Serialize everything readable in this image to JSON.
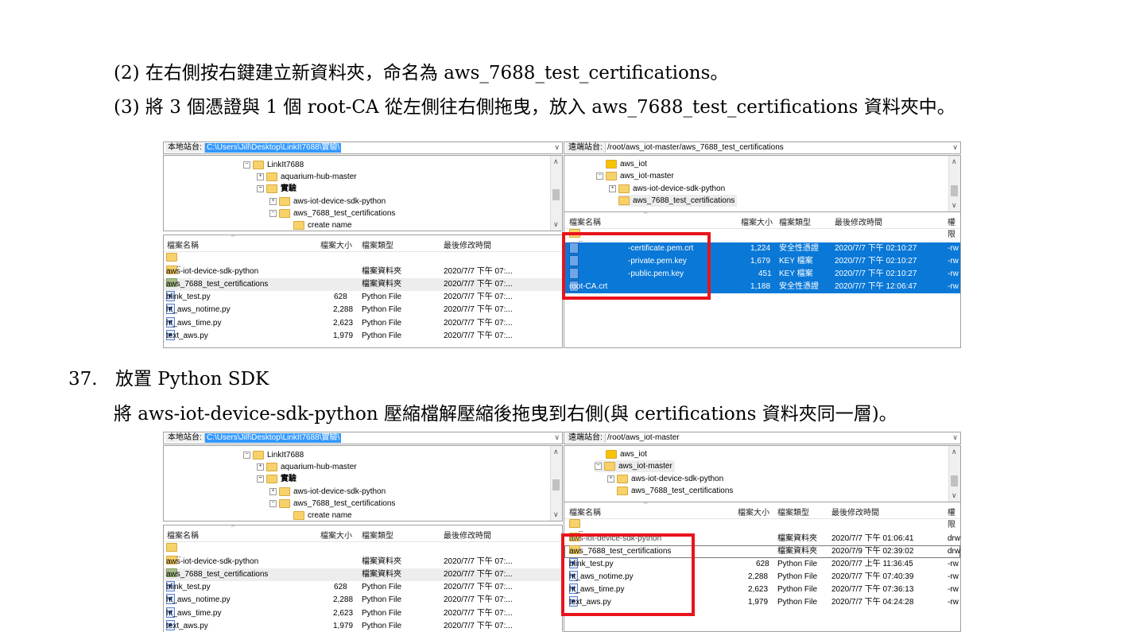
{
  "doc": {
    "line1": "(2) 在右側按右鍵建立新資料夾，命名為 aws_7688_test_certifications。",
    "line2": "(3) 將 3 個憑證與 1 個 root-CA 從左側往右側拖曳，放入 aws_7688_test_certifications 資料夾中。",
    "section_num": "37.",
    "section_title": "放置 Python SDK",
    "line3": "將 aws-iot-device-sdk-python 壓縮檔解壓縮後拖曳到右側(與 certifications 資料夾同一層)。"
  },
  "colors": {
    "selection_blue": "#0a78d7",
    "highlight_red": "#e8141c",
    "path_blue": "#3399ff"
  },
  "shot1": {
    "left": {
      "path_label": "本地站台:",
      "path_value": "C:\\Users\\Jill\\Desktop\\LinkIt7688\\實驗\\",
      "tree": [
        "LinkIt7688",
        "aquarium-hub-master",
        "實驗",
        "aws-iot-device-sdk-python",
        "aws_7688_test_certifications",
        "create name"
      ],
      "headers": {
        "name": "檔案名稱",
        "size": "檔案大小",
        "type": "檔案類型",
        "modified": "最後修改時間"
      },
      "rows": [
        {
          "name": "..",
          "size": "",
          "type": "",
          "modified": ""
        },
        {
          "name": "aws-iot-device-sdk-python",
          "size": "",
          "type": "檔案資料夾",
          "modified": "2020/7/7 下午 07:..."
        },
        {
          "name": "aws_7688_test_certifications",
          "size": "",
          "type": "檔案資料夾",
          "modified": "2020/7/7 下午 07:..."
        },
        {
          "name": "blink_test.py",
          "size": "628",
          "type": "Python File",
          "modified": "2020/7/7 下午 07:..."
        },
        {
          "name": "ht_aws_notime.py",
          "size": "2,288",
          "type": "Python File",
          "modified": "2020/7/7 下午 07:..."
        },
        {
          "name": "ht_aws_time.py",
          "size": "2,623",
          "type": "Python File",
          "modified": "2020/7/7 下午 07:..."
        },
        {
          "name": "text_aws.py",
          "size": "1,979",
          "type": "Python File",
          "modified": "2020/7/7 下午 07:..."
        }
      ]
    },
    "right": {
      "path_label": "遠端站台:",
      "path_value": "/root/aws_iot-master/aws_7688_test_certifications",
      "tree": [
        "aws_iot",
        "aws_iot-master",
        "aws-iot-device-sdk-python",
        "aws_7688_test_certifications"
      ],
      "headers": {
        "name": "檔案名稱",
        "size": "檔案大小",
        "type": "檔案類型",
        "modified": "最後修改時間",
        "perm": "權限"
      },
      "rows": [
        {
          "name": "..",
          "size": "",
          "type": "",
          "modified": "",
          "perm": ""
        },
        {
          "name": "-certificate.pem.crt",
          "size": "1,224",
          "type": "安全性憑證",
          "modified": "2020/7/7 下午 02:10:27",
          "perm": "-rw"
        },
        {
          "name": "-private.pem.key",
          "size": "1,679",
          "type": "KEY 檔案",
          "modified": "2020/7/7 下午 02:10:27",
          "perm": "-rw"
        },
        {
          "name": "-public.pem.key",
          "size": "451",
          "type": "KEY 檔案",
          "modified": "2020/7/7 下午 02:10:27",
          "perm": "-rw"
        },
        {
          "name": "root-CA.crt",
          "size": "1,188",
          "type": "安全性憑證",
          "modified": "2020/7/7 下午 12:06:47",
          "perm": "-rw"
        }
      ]
    }
  },
  "shot2": {
    "left": {
      "path_label": "本地站台:",
      "path_value": "C:\\Users\\Jill\\Desktop\\LinkIt7688\\實驗\\",
      "tree": [
        "LinkIt7688",
        "aquarium-hub-master",
        "實驗",
        "aws-iot-device-sdk-python",
        "aws_7688_test_certifications",
        "create name"
      ],
      "headers": {
        "name": "檔案名稱",
        "size": "檔案大小",
        "type": "檔案類型",
        "modified": "最後修改時間"
      },
      "rows": [
        {
          "name": "..",
          "size": "",
          "type": "",
          "modified": ""
        },
        {
          "name": "aws-iot-device-sdk-python",
          "size": "",
          "type": "檔案資料夾",
          "modified": "2020/7/7 下午 07:..."
        },
        {
          "name": "aws_7688_test_certifications",
          "size": "",
          "type": "檔案資料夾",
          "modified": "2020/7/7 下午 07:..."
        },
        {
          "name": "blink_test.py",
          "size": "628",
          "type": "Python File",
          "modified": "2020/7/7 下午 07:..."
        },
        {
          "name": "ht_aws_notime.py",
          "size": "2,288",
          "type": "Python File",
          "modified": "2020/7/7 下午 07:..."
        },
        {
          "name": "ht_aws_time.py",
          "size": "2,623",
          "type": "Python File",
          "modified": "2020/7/7 下午 07:..."
        },
        {
          "name": "text_aws.py",
          "size": "1,979",
          "type": "Python File",
          "modified": "2020/7/7 下午 07:..."
        }
      ]
    },
    "right": {
      "path_label": "遠端站台:",
      "path_value": "/root/aws_iot-master",
      "tree": [
        "aws_iot",
        "aws_iot-master",
        "aws-iot-device-sdk-python",
        "aws_7688_test_certifications"
      ],
      "headers": {
        "name": "檔案名稱",
        "size": "檔案大小",
        "type": "檔案類型",
        "modified": "最後修改時間",
        "perm": "權限"
      },
      "rows": [
        {
          "name": "..",
          "size": "",
          "type": "",
          "modified": "",
          "perm": ""
        },
        {
          "name": "aws-iot-device-sdk-python",
          "size": "",
          "type": "檔案資料夾",
          "modified": "2020/7/7 下午 01:06:41",
          "perm": "drw"
        },
        {
          "name": "aws_7688_test_certifications",
          "size": "",
          "type": "檔案資料夾",
          "modified": "2020/7/9 下午 02:39:02",
          "perm": "drw"
        },
        {
          "name": "blink_test.py",
          "size": "628",
          "type": "Python File",
          "modified": "2020/7/7 上午 11:36:45",
          "perm": "-rw"
        },
        {
          "name": "ht_aws_notime.py",
          "size": "2,288",
          "type": "Python File",
          "modified": "2020/7/7 下午 07:40:39",
          "perm": "-rw"
        },
        {
          "name": "ht_aws_time.py",
          "size": "2,623",
          "type": "Python File",
          "modified": "2020/7/7 下午 07:36:13",
          "perm": "-rw"
        },
        {
          "name": "text_aws.py",
          "size": "1,979",
          "type": "Python File",
          "modified": "2020/7/7 下午 04:24:28",
          "perm": "-rw"
        }
      ]
    }
  }
}
